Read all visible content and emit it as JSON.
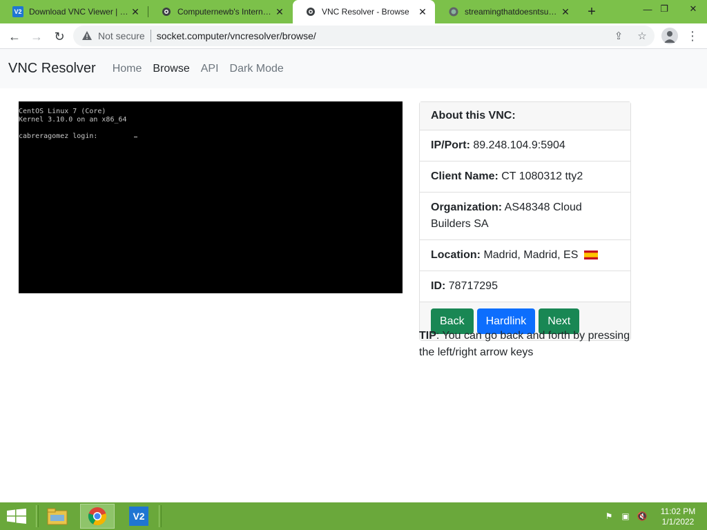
{
  "browser": {
    "tabs": [
      {
        "title": "Download VNC Viewer | VNC",
        "favicon": "vnc-icon",
        "active": false
      },
      {
        "title": "Computernewb's Internet VNC",
        "favicon": "bug-icon",
        "active": false
      },
      {
        "title": "VNC Resolver - Browse",
        "favicon": "bug-icon",
        "active": true
      },
      {
        "title": "streamingthatdoesntsuck.com",
        "favicon": "globe-icon",
        "active": false
      }
    ],
    "new_tab": "+",
    "window_controls": {
      "minimize": "—",
      "maximize": "❐",
      "close": "✕"
    },
    "security_label": "Not secure",
    "url": "socket.computer/vncresolver/browse/",
    "accent": "#7cc14a"
  },
  "site": {
    "brand": "VNC Resolver",
    "nav": [
      "Home",
      "Browse",
      "API",
      "Dark Mode"
    ],
    "active_nav": "Browse"
  },
  "vnc": {
    "lines": [
      "CentOS Linux 7 (Core)",
      "Kernel 3.10.0 on an x86_64",
      "",
      "cabreragomez login:"
    ]
  },
  "about": {
    "header": "About this VNC:",
    "ip_label": "IP/Port:",
    "ip_value": "89.248.104.9:5904",
    "client_label": "Client Name:",
    "client_value": "CT 1080312 tty2",
    "org_label": "Organization:",
    "org_value": "AS48348 Cloud Builders SA",
    "location_label": "Location:",
    "location_value": "Madrid, Madrid, ES",
    "id_label": "ID:",
    "id_value": "78717295",
    "buttons": {
      "back": "Back",
      "hardlink": "Hardlink",
      "next": "Next"
    },
    "colors": {
      "success": "#198754",
      "primary": "#0d6efd"
    }
  },
  "tip": {
    "label": "TIP",
    "text": ": You can go back and forth by pressing the left/right arrow keys"
  },
  "taskbar": {
    "time": "11:02 PM",
    "date": "1/1/2022",
    "color": "#6aa83b"
  }
}
